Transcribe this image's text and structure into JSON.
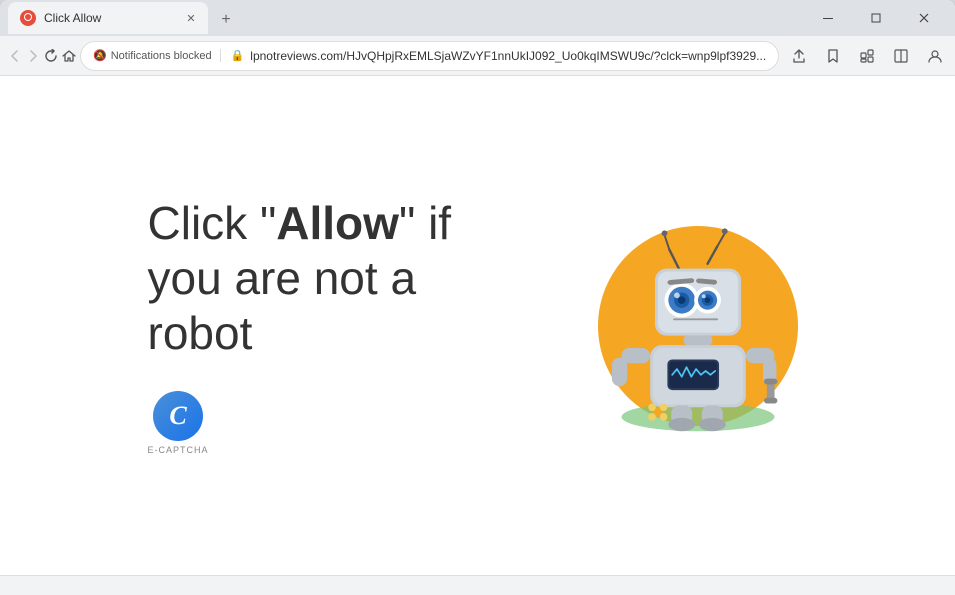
{
  "browser": {
    "tab": {
      "title": "Click Allow",
      "favicon_label": "favicon"
    },
    "new_tab_icon": "+",
    "window_controls": {
      "minimize": "─",
      "maximize": "□",
      "close": "✕",
      "restore": "❐"
    },
    "nav": {
      "back": "←",
      "forward": "→",
      "reload": "↻",
      "home": "⌂"
    },
    "address_bar": {
      "notification_blocked_text": "Notifications blocked",
      "url": "lpnotreviews.com/HJvQHpjRxEMLSjaWZvYF1nnUkIJ092_Uo0kqIMSWU9c/?clck=wnp9lpf3929...",
      "lock_icon": "🔒"
    },
    "toolbar_icons": {
      "share": "⬆",
      "bookmark": "☆",
      "extensions": "🧩",
      "split": "▣",
      "profile": "👤",
      "menu": "⋮"
    }
  },
  "page": {
    "heading_part1": "Click \"",
    "heading_bold": "Allow",
    "heading_part2": "\" if you are not a robot",
    "captcha": {
      "label": "E-CAPTCHA",
      "c_letter": "C"
    }
  },
  "status_bar": {
    "text": ""
  }
}
